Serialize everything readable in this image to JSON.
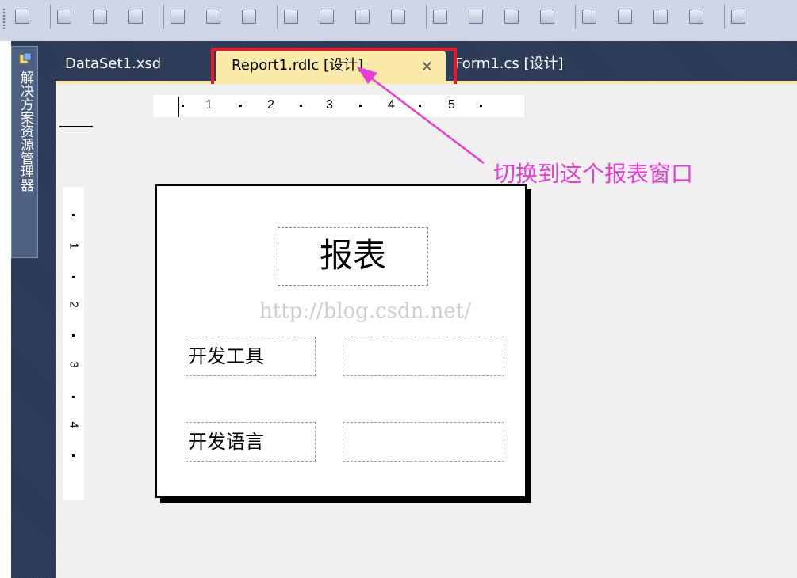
{
  "toolbar": {
    "icons": [
      "align-grid-icon",
      "align-left-icon",
      "align-center-icon",
      "align-right-icon",
      "align-top-icon",
      "align-middle-icon",
      "align-bottom-icon",
      "make-same-width-icon",
      "make-same-height-icon",
      "make-same-size-icon",
      "size-to-grid-icon",
      "horizontal-spacing-equal-icon",
      "increase-horizontal-spacing-icon",
      "decrease-horizontal-spacing-icon",
      "remove-horizontal-spacing-icon",
      "vertical-spacing-equal-icon",
      "increase-vertical-spacing-icon",
      "decrease-vertical-spacing-icon",
      "remove-vertical-spacing-icon",
      "center-horizontally-icon"
    ]
  },
  "explorer": {
    "label": "解决方案资源管理器"
  },
  "tabs": [
    {
      "label": "DataSet1.xsd",
      "active": false
    },
    {
      "label": "Report1.rdlc [设计]",
      "active": true,
      "close": "×"
    },
    {
      "label": "Form1.cs [设计]",
      "active": false
    }
  ],
  "ruler": {
    "top_numbers": [
      "1",
      "2",
      "3",
      "4",
      "5"
    ],
    "left_numbers": [
      "1",
      "2",
      "3",
      "4"
    ]
  },
  "report": {
    "title": "报表",
    "fields": [
      {
        "label": "开发工具",
        "value": ""
      },
      {
        "label": "开发语言",
        "value": ""
      }
    ]
  },
  "watermark": "http://blog.csdn.net/",
  "annotation": "切换到这个报表窗口",
  "colors": {
    "highlight": "#e8182e",
    "annotation": "#e93bd6",
    "active_tab": "#fbe9a8",
    "chrome": "#293955"
  }
}
